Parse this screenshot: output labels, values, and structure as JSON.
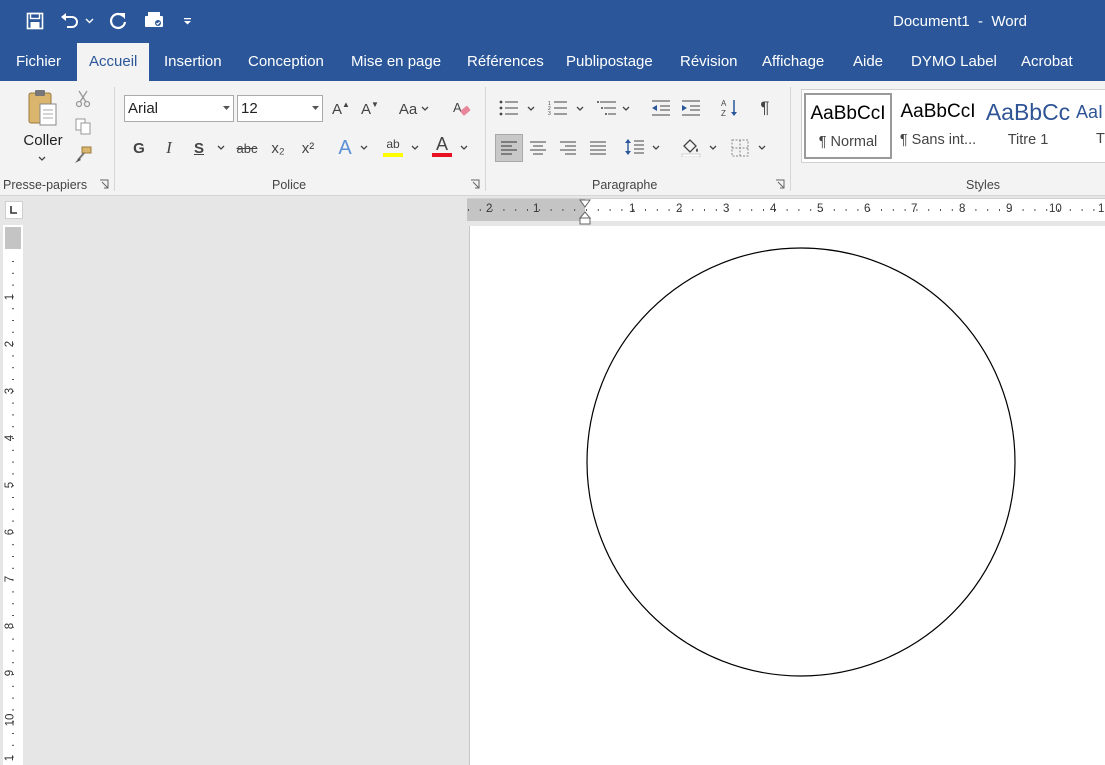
{
  "window": {
    "title": "Document1  -  Word"
  },
  "quick_access": {
    "icons": [
      "save-icon",
      "undo-icon",
      "redo-icon",
      "touch-mode-icon",
      "customize-qat-icon"
    ]
  },
  "tabs": [
    {
      "label": "Fichier"
    },
    {
      "label": "Accueil",
      "active": true
    },
    {
      "label": "Insertion"
    },
    {
      "label": "Conception"
    },
    {
      "label": "Mise en page"
    },
    {
      "label": "Références"
    },
    {
      "label": "Publipostage"
    },
    {
      "label": "Révision"
    },
    {
      "label": "Affichage"
    },
    {
      "label": "Aide"
    },
    {
      "label": "DYMO Label"
    },
    {
      "label": "Acrobat"
    }
  ],
  "clipboard": {
    "paste_label": "Coller",
    "group_label": "Presse-papiers"
  },
  "font": {
    "name": "Arial",
    "size": "12",
    "group_label": "Police",
    "change_case_label": "Aa",
    "bold_label": "G",
    "italic_label": "I",
    "underline_label": "S",
    "strike_label": "abc",
    "subscript_label": "x₂",
    "superscript_label": "x²",
    "text_effects_label": "A",
    "highlight_label": "ab",
    "font_color_label": "A",
    "grow_label": "A",
    "shrink_label": "A",
    "highlight_color": "#ffff00",
    "font_color": "#e81123"
  },
  "paragraph": {
    "group_label": "Paragraphe",
    "pilcrow": "¶"
  },
  "styles": {
    "group_label": "Styles",
    "items": [
      {
        "sample": "AaBbCcI",
        "name": "¶ Normal",
        "selected": true
      },
      {
        "sample": "AaBbCcI",
        "name": "¶ Sans int..."
      },
      {
        "sample": "AaBbCc",
        "name": "Titre 1",
        "color": "#2f5496"
      },
      {
        "sample": "AaI",
        "name": "T",
        "color": "#2f5496"
      }
    ]
  },
  "hruler": {
    "labels": [
      "2",
      "1",
      "1",
      "2",
      "3",
      "4",
      "5",
      "6",
      "7",
      "8",
      "9",
      "10",
      "1"
    ]
  },
  "vruler": {
    "labels": [
      "1",
      "2",
      "3",
      "4",
      "5",
      "6",
      "7",
      "8",
      "9",
      "10",
      "1"
    ]
  },
  "colors": {
    "accent": "#2b579a",
    "ribbon": "#f3f3f3",
    "canvas": "#e6e6e6"
  }
}
